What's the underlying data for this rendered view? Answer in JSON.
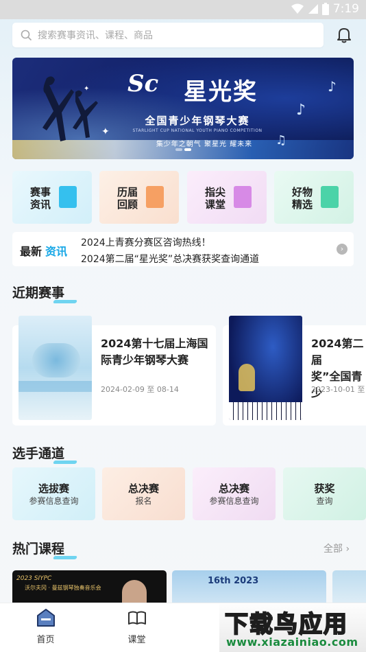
{
  "status_bar": {
    "time": "7:19"
  },
  "search": {
    "placeholder": "搜索赛事资讯、课程、商品"
  },
  "banner": {
    "logo": "Sc",
    "title": "星光奖",
    "subtitle": "全国青少年钢琴大赛",
    "subtitle_en": "STARLIGHT CUP NATIONAL YOUTH PIANO COMPETITION",
    "slogan": "集少年之朝气  聚星光  耀未来"
  },
  "quick_access": [
    {
      "label": "赛事资讯",
      "color": "#dff3fa",
      "icon_color": "#35c0ee"
    },
    {
      "label": "历届回顾",
      "color": "#fbe8dc",
      "icon_color": "#f6a063"
    },
    {
      "label": "指尖课堂",
      "color": "#f6e4f7",
      "icon_color": "#d78ae6"
    },
    {
      "label": "好物精选",
      "color": "#dff5ec",
      "icon_color": "#4bd3a8"
    }
  ],
  "news": {
    "tag_a": "最新",
    "tag_b": "资讯",
    "items": [
      "2024上青赛分赛区咨询热线！",
      "2024第二届“星光奖”总决赛获奖查询通道"
    ]
  },
  "sections": {
    "recent_events": "近期赛事",
    "player_channel": "选手通道",
    "hot_courses": "热门课程",
    "hot_courses_more": "全部"
  },
  "events": [
    {
      "name_line1": "2024第十七届上海国",
      "name_line2": "际青少年钢琴大赛",
      "date": "2024-02-09 至 08-14"
    },
    {
      "name_line1": "2024第二届",
      "name_line2": "奖”全国青少",
      "date": "2023-10-01 至"
    }
  ],
  "player_channels": [
    {
      "title": "选拔赛",
      "subtitle": "参赛信息查询",
      "color": "#dcf2f8"
    },
    {
      "title": "总决赛",
      "subtitle": "报名",
      "color": "#fae7dc"
    },
    {
      "title": "总决赛",
      "subtitle": "参赛信息查询",
      "color": "#f5e5f6"
    },
    {
      "title": "获奖",
      "subtitle": "查询",
      "color": "#dcf3ea"
    }
  ],
  "courses": [
    {
      "caption": "2023 SIYPC",
      "caption2": "沃尔夫冈 · 曼兹钢琴独奏音乐会"
    },
    {
      "caption": "16th 2023"
    }
  ],
  "tabs": [
    {
      "label": "首页"
    },
    {
      "label": "课堂"
    }
  ],
  "watermark": {
    "text": "下载鸟应用",
    "url": "www.xiazainiao.com"
  }
}
